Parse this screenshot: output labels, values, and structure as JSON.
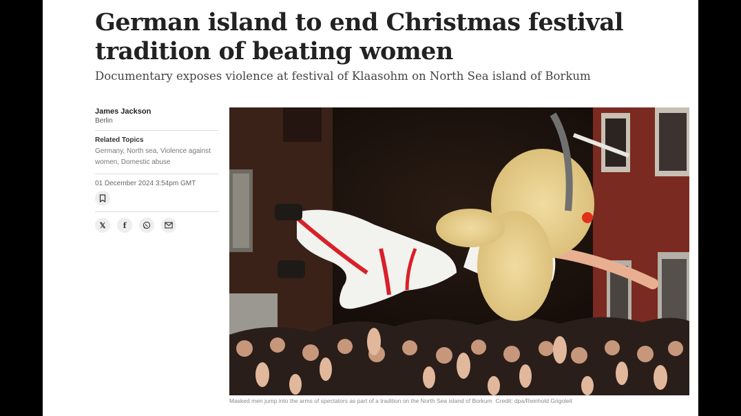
{
  "article": {
    "headline": "German island to end Christmas festival tradition of beating women",
    "standfirst": "Documentary exposes violence at festival of Klaasohm on North Sea island of Borkum"
  },
  "byline": {
    "author": "James Jackson",
    "location": "Berlin"
  },
  "related": {
    "heading": "Related Topics",
    "topics": "Germany, North sea, Violence against women, Domestic abuse"
  },
  "date": "01 December 2024 3:54pm GMT",
  "icons": {
    "bookmark": "bookmark-icon",
    "share": [
      "x-icon",
      "facebook-icon",
      "whatsapp-icon",
      "email-icon"
    ]
  },
  "share": {
    "x_glyph": "𝕏",
    "facebook_glyph": "f"
  },
  "photo": {
    "caption": "Masked men jump into the arms of spectators as part of a tradition on the North Sea island of Borkum",
    "credit": "Credit: dpa/Reinhold Grigoleit"
  },
  "colors": {
    "outer_background": "#000000",
    "page_background": "#ffffff",
    "headline": "#222222",
    "costume_stripe": "#d8202a"
  }
}
